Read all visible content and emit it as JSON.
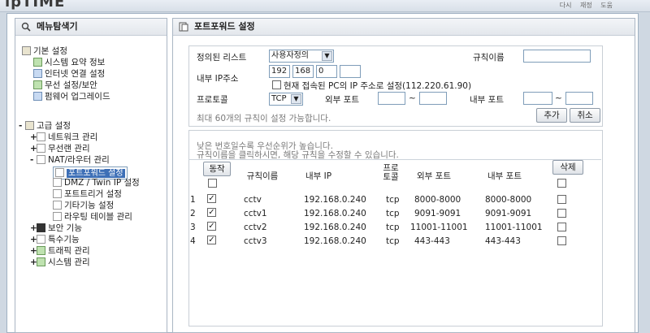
{
  "app": {
    "logo": "ipTIME",
    "top_links": [
      "다시",
      "재정",
      "도움"
    ]
  },
  "left": {
    "title": "메뉴탐색기",
    "basic": {
      "label": "기본 설정",
      "items": [
        "시스템 요약 정보",
        "인터넷 연결 설정",
        "무선 설정/보안",
        "펌웨어 업그레이드"
      ]
    },
    "advanced": {
      "label": "고급 설정",
      "items": [
        "네트워크 관리",
        "무선랜 관리",
        "NAT/라우터 관리"
      ],
      "nat_sub": [
        "포트포워드 설정",
        "DMZ / Twin IP 설정",
        "포트트리거 설정",
        "기타기능 설정",
        "라우팅 테이블 관리"
      ],
      "more": [
        "보안 기능",
        "특수기능",
        "트래픽 관리",
        "시스템 관리"
      ]
    }
  },
  "right": {
    "title": "포트포워드 설정",
    "form": {
      "predefined_label": "정의된 리스트",
      "predefined_value": "사용자정의",
      "rule_name_label": "규칙이름",
      "rule_name_value": "",
      "internal_ip_label": "내부 IP주소",
      "ip_parts": [
        "192",
        "168",
        "0",
        ""
      ],
      "current_ip_text": "현재 접속된 PC의 IP 주소로 설정(112.220.61.90)",
      "protocol_label": "프로토콜",
      "protocol_value": "TCP",
      "ext_port_label": "외부 포트",
      "int_port_label": "내부 포트",
      "tilde": "~",
      "limit_note": "최대 60개의 규칙이 설정 가능합니다.",
      "add_button": "추가",
      "cancel_button": "취소"
    },
    "notes": [
      "낮은 번호일수록 우선순위가 높습니다.",
      "규칙이름을 클릭하시면, 해당 규칙을 수정할 수 있습니다."
    ],
    "table": {
      "run_button": "동작",
      "delete_button": "삭제",
      "headers": [
        "규칙이름",
        "내부 IP",
        "프로토콜",
        "외부 포트",
        "내부 포트"
      ],
      "rows": [
        {
          "num": "1",
          "name": "cctv",
          "ip": "192.168.0.240",
          "proto": "tcp",
          "ext": "8000-8000",
          "int": "8000-8000",
          "enabled": true
        },
        {
          "num": "2",
          "name": "cctv1",
          "ip": "192.168.0.240",
          "proto": "tcp",
          "ext": "9091-9091",
          "int": "9091-9091",
          "enabled": true
        },
        {
          "num": "3",
          "name": "cctv2",
          "ip": "192.168.0.240",
          "proto": "tcp",
          "ext": "11001-11001",
          "int": "11001-11001",
          "enabled": true
        },
        {
          "num": "4",
          "name": "cctv3",
          "ip": "192.168.0.240",
          "proto": "tcp",
          "ext": "443-443",
          "int": "443-443",
          "enabled": true
        }
      ]
    }
  }
}
